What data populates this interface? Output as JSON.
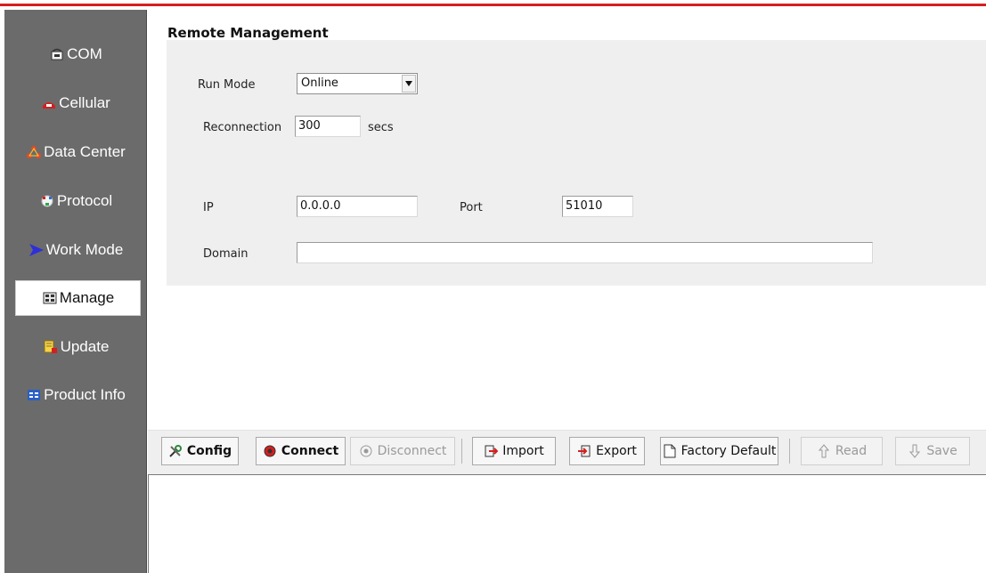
{
  "sidebar": {
    "items": [
      {
        "label": "COM",
        "icon": "phone-icon"
      },
      {
        "label": "Cellular",
        "icon": "cellular-icon"
      },
      {
        "label": "Data Center",
        "icon": "network-icon"
      },
      {
        "label": "Protocol",
        "icon": "protocol-icon"
      },
      {
        "label": "Work Mode",
        "icon": "arrow-icon"
      },
      {
        "label": "Manage",
        "icon": "manage-icon",
        "active": true
      },
      {
        "label": "Update",
        "icon": "update-icon"
      },
      {
        "label": "Product Info",
        "icon": "info-icon"
      }
    ]
  },
  "main": {
    "title": "Remote Management",
    "run_mode": {
      "label": "Run Mode",
      "value": "Online"
    },
    "reconnection": {
      "label": "Reconnection",
      "value": "300",
      "unit": "secs"
    },
    "ip": {
      "label": "IP",
      "value": "0.0.0.0"
    },
    "port": {
      "label": "Port",
      "value": "51010"
    },
    "domain": {
      "label": "Domain",
      "value": ""
    }
  },
  "toolbar": {
    "config": "Config",
    "connect": "Connect",
    "disconnect": "Disconnect",
    "import": "Import",
    "export": "Export",
    "factory_default": "Factory Default",
    "read": "Read",
    "save": "Save"
  },
  "colors": {
    "accent_red": "#d51f1f",
    "sidebar_bg": "#6b6b6b",
    "panel_bg": "#efefef"
  }
}
